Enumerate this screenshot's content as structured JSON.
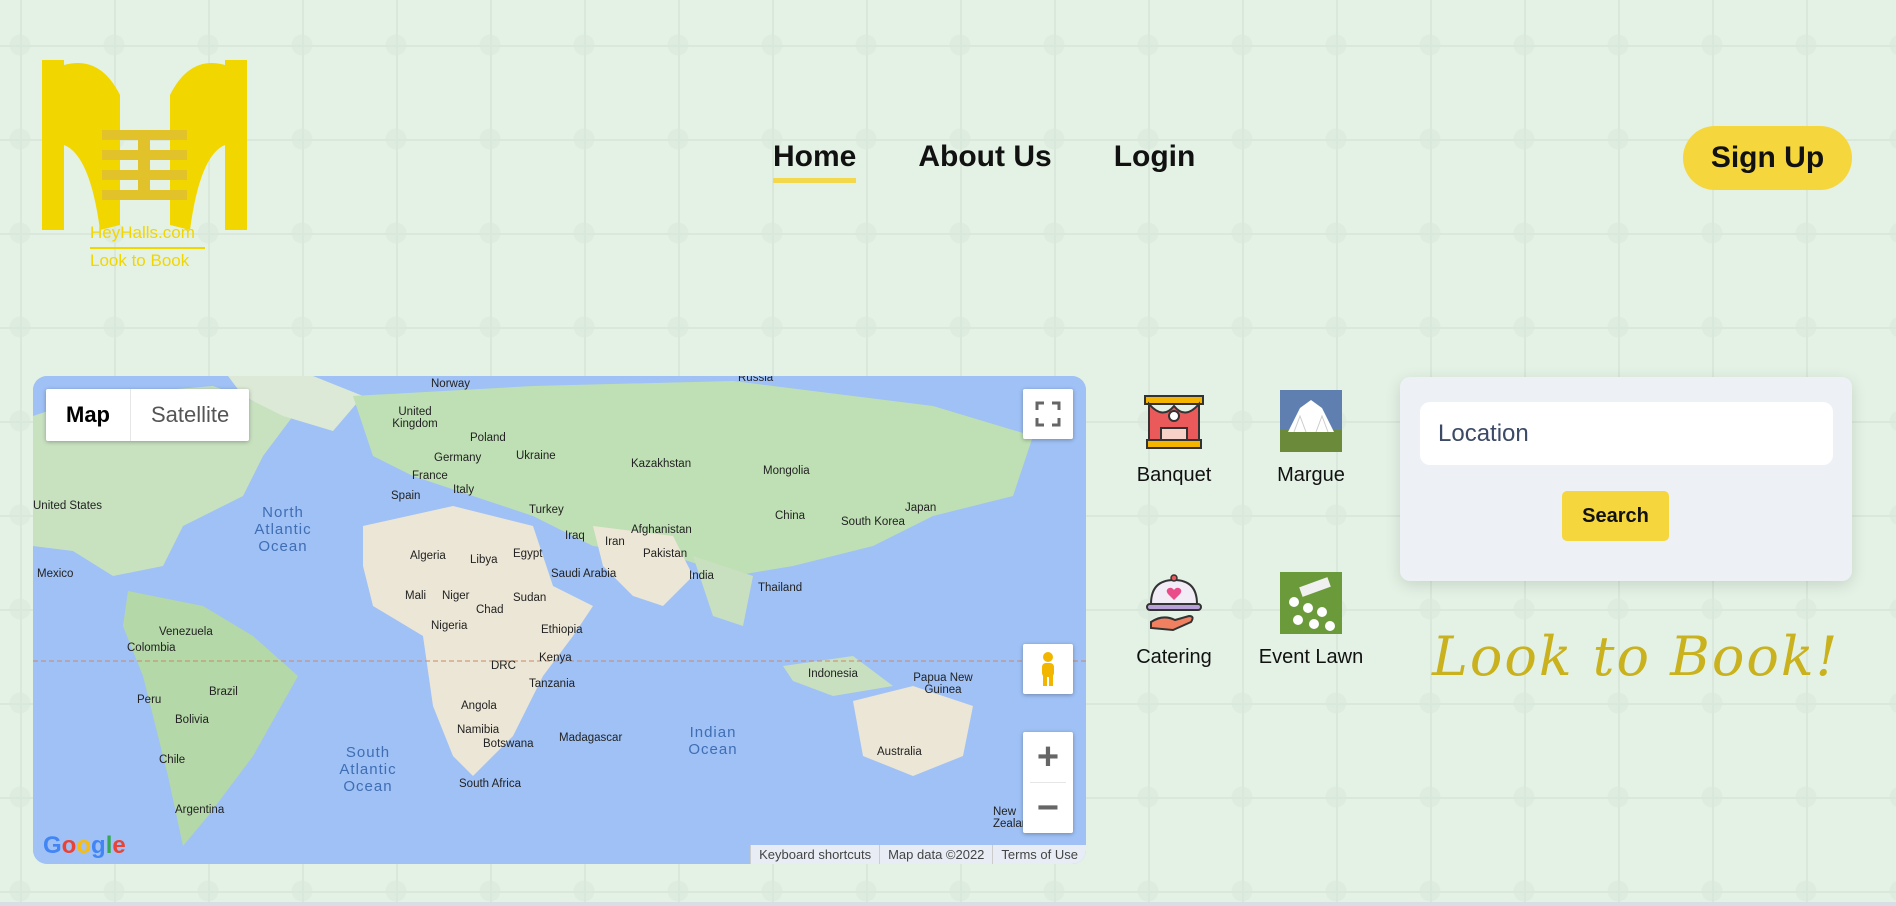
{
  "logo": {
    "line1": "HeyHalls.com",
    "line2": "Look to Book"
  },
  "nav": {
    "home": "Home",
    "about": "About Us",
    "login": "Login"
  },
  "signup_label": "Sign Up",
  "map": {
    "type_map": "Map",
    "type_satellite": "Satellite",
    "attribution": {
      "shortcuts": "Keyboard shortcuts",
      "data": "Map data ©2022",
      "terms": "Terms of Use"
    },
    "google": "Google",
    "labels": [
      "Russia",
      "Norway",
      "United Kingdom",
      "Poland",
      "Germany",
      "Ukraine",
      "France",
      "Kazakhstan",
      "Mongolia",
      "Spain",
      "Italy",
      "Turkey",
      "United States",
      "Iraq",
      "Iran",
      "Afghanistan",
      "China",
      "South Korea",
      "Japan",
      "Algeria",
      "Libya",
      "Egypt",
      "Pakistan",
      "Saudi Arabia",
      "India",
      "Mexico",
      "Mali",
      "Niger",
      "Sudan",
      "Chad",
      "Thailand",
      "Nigeria",
      "Ethiopia",
      "Venezuela",
      "Colombia",
      "Kenya",
      "DRC",
      "Indonesia",
      "Papua New Guinea",
      "Tanzania",
      "Peru",
      "Brazil",
      "Angola",
      "Bolivia",
      "Namibia",
      "Madagascar",
      "Botswana",
      "Australia",
      "Chile",
      "South Africa",
      "Argentina",
      "New Zealand"
    ],
    "oceans": {
      "north_atlantic": "North Atlantic Ocean",
      "south_atlantic": "South Atlantic Ocean",
      "indian": "Indian Ocean"
    }
  },
  "categories": [
    "Banquet",
    "Margue",
    "Catering",
    "Event Lawn"
  ],
  "search": {
    "placeholder": "Location",
    "button": "Search"
  },
  "tagline": "Look to Book!"
}
